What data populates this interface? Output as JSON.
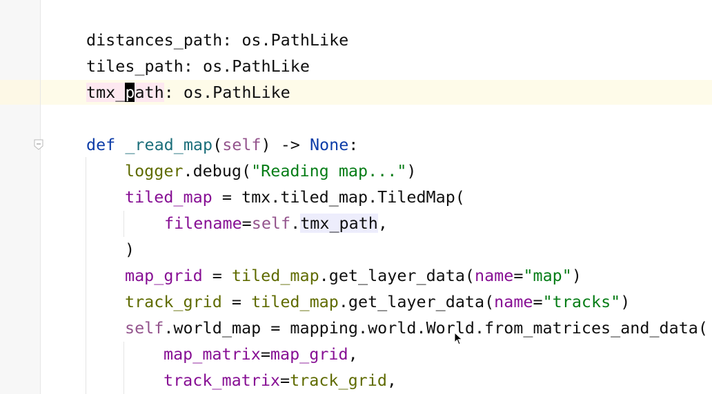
{
  "editor": {
    "language": "python",
    "lines": {
      "l1": {
        "name": "distances_path",
        "sep": ": ",
        "type": "os.PathLike"
      },
      "l2": {
        "name": "tiles_path",
        "sep": ": ",
        "type": "os.PathLike"
      },
      "l3": {
        "pre": "tmx_",
        "caret": "p",
        "post": "ath",
        "sep": ": ",
        "type": "os.PathLike"
      },
      "l5": {
        "kw": "def",
        "fn": "_read_map",
        "open": "(",
        "self": "self",
        "close": ") -> ",
        "none": "None",
        "colon": ":"
      },
      "l6": {
        "obj": "logger",
        "call": ".debug(",
        "str": "\"Reading map...\"",
        "close": ")"
      },
      "l7": {
        "var": "tiled_map",
        "rest": " = tmx.tiled_map.TiledMap("
      },
      "l8": {
        "param": "filename",
        "eq": "=",
        "self": "self",
        "dot": ".",
        "attr": "tmx_path",
        "comma": ","
      },
      "l9": {
        "text": ")"
      },
      "l10": {
        "var": "map_grid",
        "eq": " = ",
        "obj": "tiled_map",
        "call": ".get_layer_data(",
        "param": "name",
        "peq": "=",
        "str": "\"map\"",
        "close": ")"
      },
      "l11": {
        "var": "track_grid",
        "eq": " = ",
        "obj": "tiled_map",
        "call": ".get_layer_data(",
        "param": "name",
        "peq": "=",
        "str": "\"tracks\"",
        "close": ")"
      },
      "l12": {
        "self": "self",
        "rest": ".world_map = mapping.world.World.from_matrices_and_data("
      },
      "l13": {
        "param": "map_matrix",
        "eq": "=",
        "var": "map_grid",
        "comma": ","
      },
      "l14": {
        "param": "track_matrix",
        "eq": "=",
        "var": "track_grid",
        "comma": ","
      }
    }
  }
}
